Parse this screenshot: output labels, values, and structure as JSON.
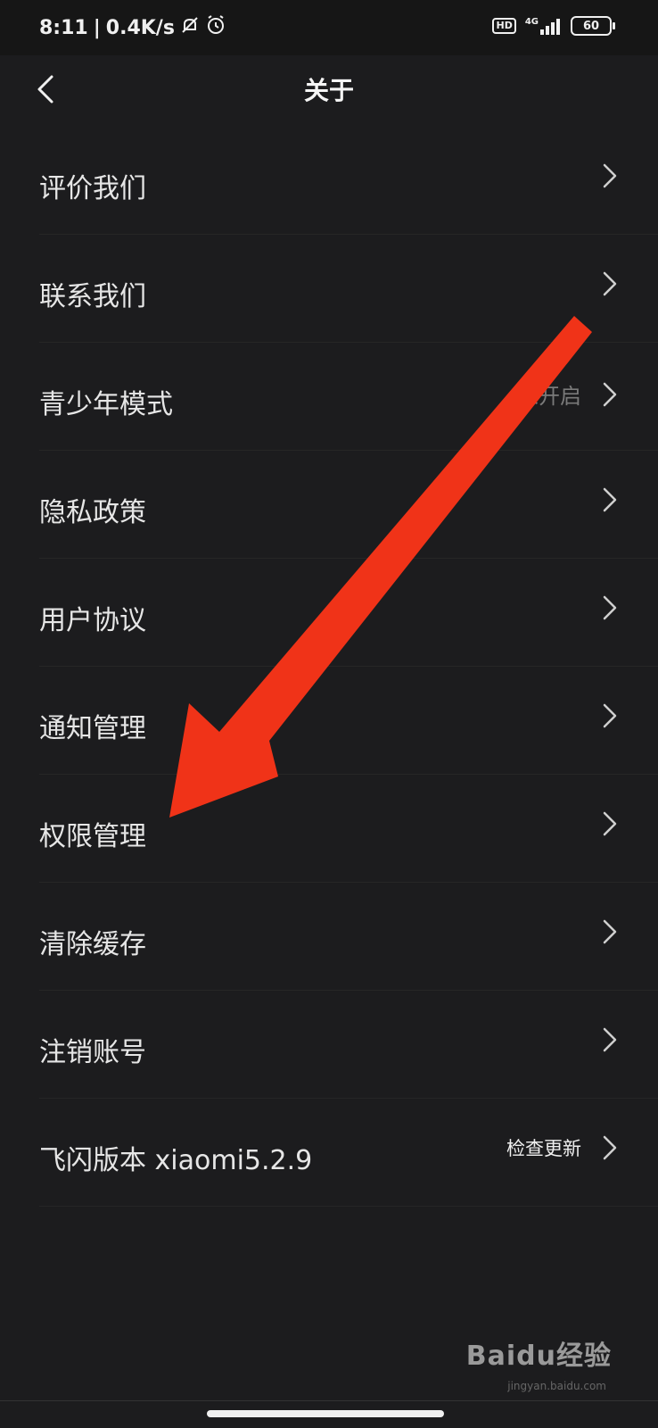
{
  "status_bar": {
    "time": "8:11",
    "network_speed": "0.4K/s",
    "signal": "4G",
    "hd": "HD",
    "battery": "60",
    "icons": [
      "bell-off-icon",
      "alarm-icon",
      "signal-icon",
      "battery-icon"
    ]
  },
  "header": {
    "back_icon": "chevron-left-icon",
    "title": "关于"
  },
  "menu": {
    "items": [
      {
        "label": "评价我们",
        "value": ""
      },
      {
        "label": "联系我们",
        "value": ""
      },
      {
        "label": "青少年模式",
        "value": "未开启"
      },
      {
        "label": "隐私政策",
        "value": ""
      },
      {
        "label": "用户协议",
        "value": ""
      },
      {
        "label": "通知管理",
        "value": ""
      },
      {
        "label": "权限管理",
        "value": ""
      },
      {
        "label": "清除缓存",
        "value": ""
      },
      {
        "label": "注销账号",
        "value": ""
      },
      {
        "label": "飞闪版本 xiaomi5.2.9",
        "value": "检查更新"
      }
    ]
  },
  "annotation": {
    "arrow_color": "#f03318"
  },
  "watermark": {
    "brand": "Baidu经验",
    "sub": "jingyan.baidu.com"
  },
  "colors": {
    "background": "#1c1c1e",
    "text": "#e6e6e6",
    "secondary_text": "#7a7a7a"
  }
}
